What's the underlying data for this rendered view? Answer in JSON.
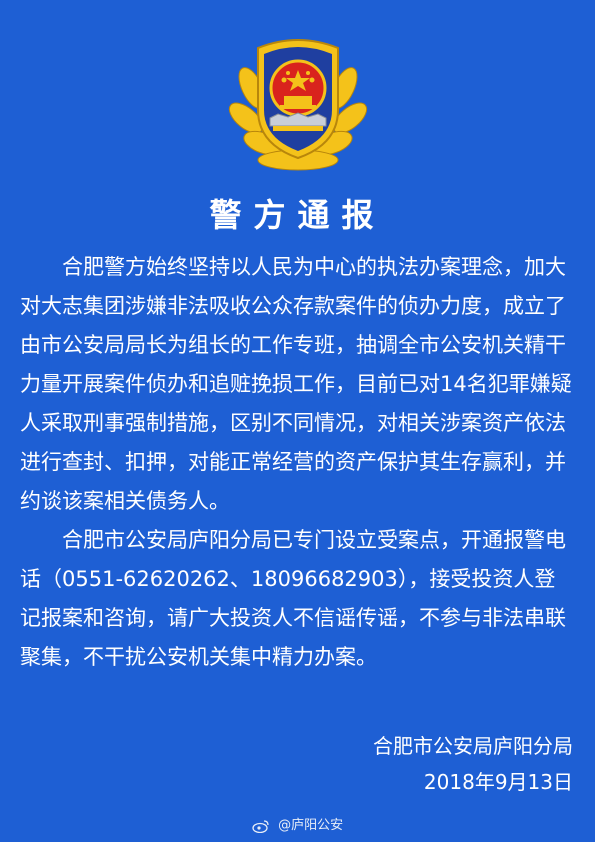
{
  "notice": {
    "title": "警方通报",
    "paragraph1": "合肥警方始终坚持以人民为中心的执法办案理念，加大对大志集团涉嫌非法吸收公众存款案件的侦办力度，成立了由市公安局局长为组长的工作专班，抽调全市公安机关精干力量开展案件侦办和追赃挽损工作，目前已对14名犯罪嫌疑人采取刑事强制措施，区别不同情况，对相关涉案资产依法进行查封、扣押，对能正常经营的资产保护其生存赢利，并约谈该案相关债务人。",
    "paragraph2": "合肥市公安局庐阳分局已专门设立受案点，开通报警电话（0551-62620262、18096682903），接受投资人登记报案和咨询，请广大投资人不信谣传谣，不参与非法串联聚集，不干扰公安机关集中精力办案。",
    "issuer": "合肥市公安局庐阳分局",
    "date": "2018年9月13日"
  },
  "watermark": {
    "icon": "weibo-icon",
    "text": "@庐阳公安"
  },
  "colors": {
    "background": "#1e5fd4",
    "text": "#ffffff",
    "emblem_red": "#d9231d",
    "emblem_gold": "#f4c21a"
  }
}
